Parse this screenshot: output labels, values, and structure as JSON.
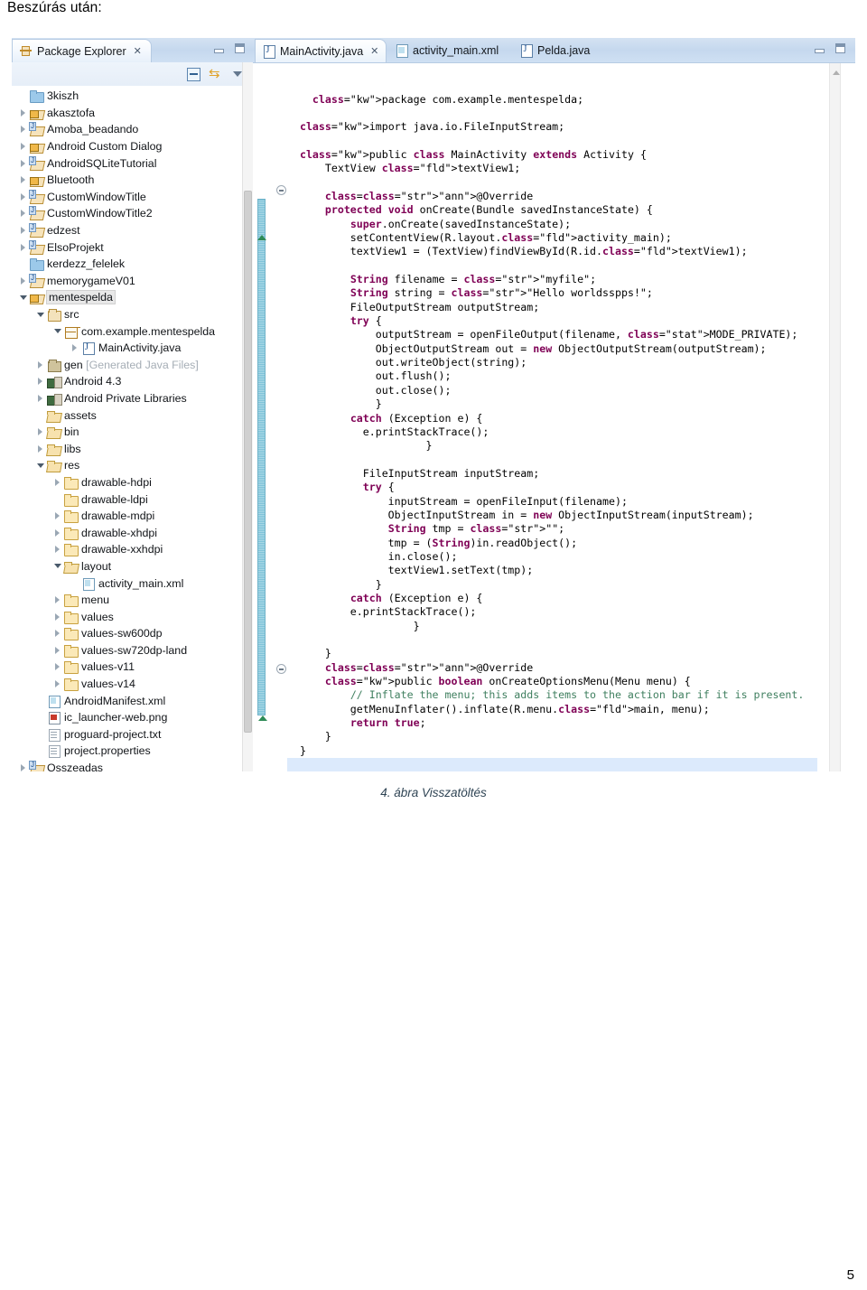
{
  "document": {
    "heading": "Beszúrás után:",
    "figure_caption": "4. ábra Visszatöltés",
    "page_number": "5"
  },
  "package_explorer": {
    "view_title": "Package Explorer",
    "close_glyph": "✕",
    "toolbar": {
      "collapse_all": "collapse-all-icon",
      "link_with_editor": "link-with-editor-icon",
      "view_menu": "view-menu-icon"
    },
    "window_buttons": {
      "minimize": "minimize-icon",
      "maximize": "maximize-icon"
    },
    "tree": [
      {
        "label": "3kiszh",
        "icon": "folder-blue",
        "indent": 0,
        "arrow": "none"
      },
      {
        "label": "akasztofa",
        "icon": "jproj-lock",
        "indent": 0,
        "arrow": "closed"
      },
      {
        "label": "Amoba_beadando",
        "icon": "jproj",
        "indent": 0,
        "arrow": "closed"
      },
      {
        "label": "Android Custom Dialog",
        "icon": "jproj-lock",
        "indent": 0,
        "arrow": "closed"
      },
      {
        "label": "AndroidSQLiteTutorial",
        "icon": "jproj",
        "indent": 0,
        "arrow": "closed"
      },
      {
        "label": "Bluetooth",
        "icon": "jproj-lock",
        "indent": 0,
        "arrow": "closed"
      },
      {
        "label": "CustomWindowTitle",
        "icon": "jproj",
        "indent": 0,
        "arrow": "closed"
      },
      {
        "label": "CustomWindowTitle2",
        "icon": "jproj",
        "indent": 0,
        "arrow": "closed"
      },
      {
        "label": "edzest",
        "icon": "jproj",
        "indent": 0,
        "arrow": "closed"
      },
      {
        "label": "ElsoProjekt",
        "icon": "jproj",
        "indent": 0,
        "arrow": "closed"
      },
      {
        "label": "kerdezz_felelek",
        "icon": "folder-blue",
        "indent": 0,
        "arrow": "none"
      },
      {
        "label": "memorygameV01",
        "icon": "jproj",
        "indent": 0,
        "arrow": "closed"
      },
      {
        "label": "mentespelda",
        "icon": "jproj-lock",
        "indent": 0,
        "arrow": "open",
        "selected": true
      },
      {
        "label": "src",
        "icon": "srcfolder",
        "indent": 1,
        "arrow": "open"
      },
      {
        "label": "com.example.mentespelda",
        "icon": "package",
        "indent": 2,
        "arrow": "open"
      },
      {
        "label": "MainActivity.java",
        "icon": "javafile",
        "indent": 3,
        "arrow": "closed"
      },
      {
        "label": "gen",
        "label2": " [Generated Java Files]",
        "icon": "genfolder",
        "indent": 1,
        "arrow": "closed"
      },
      {
        "label": "Android 4.3",
        "icon": "lib",
        "indent": 1,
        "arrow": "closed"
      },
      {
        "label": "Android Private Libraries",
        "icon": "lib",
        "indent": 1,
        "arrow": "closed"
      },
      {
        "label": "assets",
        "icon": "resfolder",
        "indent": 1,
        "arrow": "none"
      },
      {
        "label": "bin",
        "icon": "resfolder",
        "indent": 1,
        "arrow": "closed"
      },
      {
        "label": "libs",
        "icon": "resfolder",
        "indent": 1,
        "arrow": "closed"
      },
      {
        "label": "res",
        "icon": "resfolder",
        "indent": 1,
        "arrow": "open"
      },
      {
        "label": "drawable-hdpi",
        "icon": "yfolder",
        "indent": 2,
        "arrow": "closed"
      },
      {
        "label": "drawable-ldpi",
        "icon": "yfolder",
        "indent": 2,
        "arrow": "none"
      },
      {
        "label": "drawable-mdpi",
        "icon": "yfolder",
        "indent": 2,
        "arrow": "closed"
      },
      {
        "label": "drawable-xhdpi",
        "icon": "yfolder",
        "indent": 2,
        "arrow": "closed"
      },
      {
        "label": "drawable-xxhdpi",
        "icon": "yfolder",
        "indent": 2,
        "arrow": "closed"
      },
      {
        "label": "layout",
        "icon": "resfolder",
        "indent": 2,
        "arrow": "open"
      },
      {
        "label": "activity_main.xml",
        "icon": "xmlfile",
        "indent": 3,
        "arrow": "none"
      },
      {
        "label": "menu",
        "icon": "yfolder",
        "indent": 2,
        "arrow": "closed"
      },
      {
        "label": "values",
        "icon": "yfolder",
        "indent": 2,
        "arrow": "closed"
      },
      {
        "label": "values-sw600dp",
        "icon": "yfolder",
        "indent": 2,
        "arrow": "closed"
      },
      {
        "label": "values-sw720dp-land",
        "icon": "yfolder",
        "indent": 2,
        "arrow": "closed"
      },
      {
        "label": "values-v11",
        "icon": "yfolder",
        "indent": 2,
        "arrow": "closed"
      },
      {
        "label": "values-v14",
        "icon": "yfolder",
        "indent": 2,
        "arrow": "closed"
      },
      {
        "label": "AndroidManifest.xml",
        "icon": "xmlfile",
        "indent": 1,
        "arrow": "none"
      },
      {
        "label": "ic_launcher-web.png",
        "icon": "pngfile",
        "indent": 1,
        "arrow": "none"
      },
      {
        "label": "proguard-project.txt",
        "icon": "txtfile",
        "indent": 1,
        "arrow": "none"
      },
      {
        "label": "project.properties",
        "icon": "txtfile",
        "indent": 1,
        "arrow": "none"
      },
      {
        "label": "Osszeadas",
        "icon": "jproj",
        "indent": 0,
        "arrow": "closed"
      }
    ]
  },
  "editor": {
    "tabs": [
      {
        "label": "MainActivity.java",
        "icon": "java-file-icon",
        "active": true,
        "close_glyph": "✕"
      },
      {
        "label": "activity_main.xml",
        "icon": "xml-file-icon",
        "active": false
      },
      {
        "label": "Pelda.java",
        "icon": "java-file-icon",
        "active": false
      }
    ],
    "window_buttons": {
      "minimize": "minimize-icon",
      "maximize": "maximize-icon"
    },
    "code": "    package com.example.mentespelda;\n\n  import java.io.FileInputStream;\n\n  public class MainActivity extends Activity {\n      TextView textView1;\n\n      @Override\n      protected void onCreate(Bundle savedInstanceState) {\n          super.onCreate(savedInstanceState);\n          setContentView(R.layout.activity_main);\n          textView1 = (TextView)findViewById(R.id.textView1);\n\n          String filename = \"myfile\";\n          String string = \"Hello worldsspps!\";\n          FileOutputStream outputStream;\n          try {\n              outputStream = openFileOutput(filename, MODE_PRIVATE);\n              ObjectOutputStream out = new ObjectOutputStream(outputStream);\n              out.writeObject(string);\n              out.flush();\n              out.close();\n              }\n          catch (Exception e) {\n            e.printStackTrace();\n                      }\n\n            FileInputStream inputStream;\n            try {\n                inputStream = openFileInput(filename);\n                ObjectInputStream in = new ObjectInputStream(inputStream);\n                String tmp = \"\";\n                tmp = (String)in.readObject();\n                in.close();\n                textView1.setText(tmp);\n              }\n          catch (Exception e) {\n          e.printStackTrace();\n                    }\n\n      }\n      @Override\n      public boolean onCreateOptionsMenu(Menu menu) {\n          // Inflate the menu; this adds items to the action bar if it is present.\n          getMenuInflater().inflate(R.menu.main, menu);\n          return true;\n      }\n  }"
  }
}
